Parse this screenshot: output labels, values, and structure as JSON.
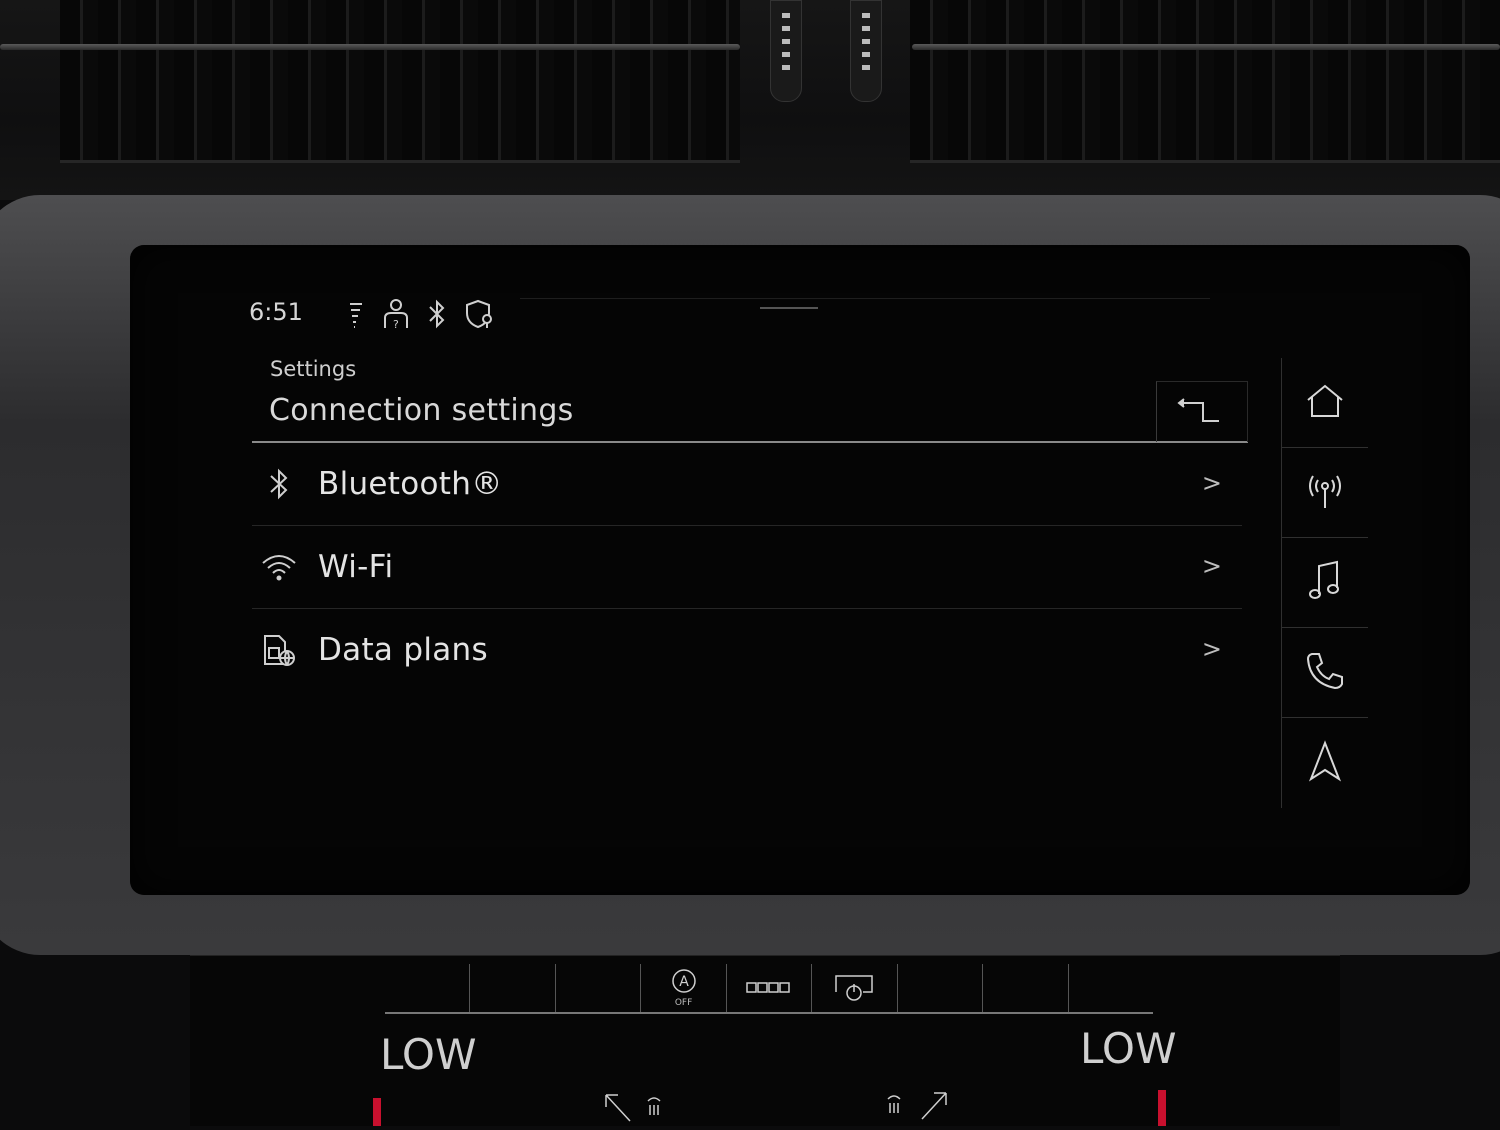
{
  "status_bar": {
    "time": "6:51",
    "icons": [
      "signal-strength-icon",
      "user-profile-icon",
      "bluetooth-icon",
      "location-privacy-icon"
    ]
  },
  "header": {
    "breadcrumb": "Settings",
    "title": "Connection settings",
    "back_icon": "back-arrow-icon"
  },
  "menu": {
    "items": [
      {
        "icon": "bluetooth-icon",
        "label": "Bluetooth®",
        "chevron": ">"
      },
      {
        "icon": "wifi-icon",
        "label": "Wi-Fi",
        "chevron": ">"
      },
      {
        "icon": "data-plan-sim-icon",
        "label": "Data plans",
        "chevron": ">"
      }
    ]
  },
  "side_nav": {
    "items": [
      "home-icon",
      "radio-icon",
      "music-icon",
      "phone-icon",
      "navigation-icon"
    ]
  },
  "climate": {
    "auto_off_label": "OFF",
    "auto_letter": "A",
    "temp_left": "LOW",
    "temp_right": "LOW"
  },
  "colors": {
    "background": "#050505",
    "text": "#e4e4e4",
    "accent_red": "#c8102e"
  }
}
